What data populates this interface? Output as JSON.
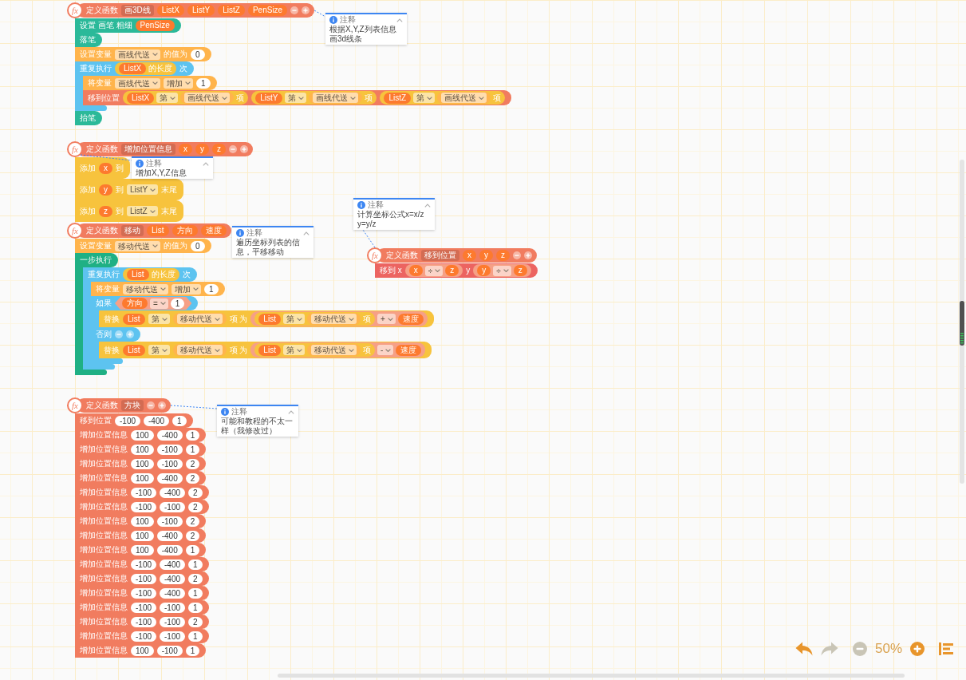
{
  "functions": [
    {
      "header": {
        "symbol": "fx",
        "parts": [
          {
            "kind": "label",
            "text": "定义函数"
          },
          {
            "kind": "name",
            "text": "画3D线"
          },
          {
            "kind": "variable",
            "text": "ListX"
          },
          {
            "kind": "variable",
            "text": "ListY"
          },
          {
            "kind": "variable",
            "text": "ListZ"
          },
          {
            "kind": "variable",
            "text": "PenSize"
          },
          {
            "kind": "mutator"
          }
        ]
      },
      "comment": {
        "title": "注释",
        "text": "根据X,Y,Z列表信息画3d线条"
      },
      "body": [
        {
          "kind": "pen",
          "parts": [
            {
              "kind": "label",
              "text": "设置 画笔 粗细"
            },
            {
              "kind": "variable",
              "text": "PenSize"
            }
          ]
        },
        {
          "kind": "pen",
          "parts": [
            {
              "kind": "label",
              "text": "落笔"
            }
          ]
        },
        {
          "kind": "variable",
          "parts": [
            {
              "kind": "label",
              "text": "设置变量"
            },
            {
              "kind": "dropdown",
              "text": "画线代送"
            },
            {
              "kind": "label",
              "text": "的值为"
            },
            {
              "kind": "number",
              "text": "0"
            }
          ]
        },
        {
          "kind": "repeat",
          "parts": [
            {
              "kind": "label",
              "text": "重复执行"
            },
            {
              "kind": "length",
              "parts": [
                {
                  "kind": "variable",
                  "text": "ListX"
                },
                {
                  "kind": "label",
                  "text": "的长度"
                }
              ]
            },
            {
              "kind": "label",
              "text": "次"
            }
          ],
          "children": [
            {
              "kind": "variable",
              "parts": [
                {
                  "kind": "label",
                  "text": "将变量"
                },
                {
                  "kind": "dropdown",
                  "text": "画线代送"
                },
                {
                  "kind": "dropdown",
                  "text": "增加"
                },
                {
                  "kind": "number",
                  "text": "1"
                }
              ]
            },
            {
              "kind": "function",
              "parts": [
                {
                  "kind": "label",
                  "text": "移到位置"
                },
                {
                  "kind": "list-item",
                  "parts": [
                    {
                      "kind": "variable",
                      "text": "ListX"
                    },
                    {
                      "kind": "dropdown",
                      "text": "第"
                    },
                    {
                      "kind": "getter",
                      "parts": [
                        {
                          "kind": "dropdown",
                          "text": "画线代送"
                        }
                      ]
                    },
                    {
                      "kind": "label",
                      "text": "项"
                    }
                  ]
                },
                {
                  "kind": "list-item",
                  "parts": [
                    {
                      "kind": "variable",
                      "text": "ListY"
                    },
                    {
                      "kind": "dropdown",
                      "text": "第"
                    },
                    {
                      "kind": "getter",
                      "parts": [
                        {
                          "kind": "dropdown",
                          "text": "画线代送"
                        }
                      ]
                    },
                    {
                      "kind": "label",
                      "text": "项"
                    }
                  ]
                },
                {
                  "kind": "list-item",
                  "parts": [
                    {
                      "kind": "variable",
                      "text": "ListZ"
                    },
                    {
                      "kind": "dropdown",
                      "text": "第"
                    },
                    {
                      "kind": "getter",
                      "parts": [
                        {
                          "kind": "dropdown",
                          "text": "画线代送"
                        }
                      ]
                    },
                    {
                      "kind": "label",
                      "text": "项"
                    }
                  ]
                }
              ]
            }
          ]
        },
        {
          "kind": "pen",
          "parts": [
            {
              "kind": "label",
              "text": "抬笔"
            }
          ]
        }
      ]
    },
    {
      "header": {
        "symbol": "fx",
        "parts": [
          {
            "kind": "label",
            "text": "定义函数"
          },
          {
            "kind": "name",
            "text": "增加位置信息"
          },
          {
            "kind": "variable",
            "text": "x"
          },
          {
            "kind": "variable",
            "text": "y"
          },
          {
            "kind": "variable",
            "text": "z"
          },
          {
            "kind": "mutator"
          }
        ]
      },
      "comment": {
        "title": "注释",
        "text": "增加X,Y,Z信息"
      },
      "body": [
        {
          "kind": "list",
          "parts": [
            {
              "kind": "label",
              "text": "添加"
            },
            {
              "kind": "variable",
              "text": "x"
            },
            {
              "kind": "label",
              "text": "到"
            }
          ]
        },
        {
          "kind": "list",
          "parts": [
            {
              "kind": "label",
              "text": "添加"
            },
            {
              "kind": "variable",
              "text": "y"
            },
            {
              "kind": "label",
              "text": "到"
            },
            {
              "kind": "dropdown",
              "text": "ListY"
            },
            {
              "kind": "label",
              "text": "末尾"
            }
          ]
        },
        {
          "kind": "list",
          "parts": [
            {
              "kind": "label",
              "text": "添加"
            },
            {
              "kind": "variable",
              "text": "z"
            },
            {
              "kind": "label",
              "text": "到"
            },
            {
              "kind": "dropdown",
              "text": "ListZ"
            },
            {
              "kind": "label",
              "text": "末尾"
            }
          ]
        }
      ]
    },
    {
      "header": {
        "symbol": "fx",
        "parts": [
          {
            "kind": "label",
            "text": "定义函数"
          },
          {
            "kind": "name",
            "text": "移动"
          },
          {
            "kind": "variable",
            "text": "List"
          },
          {
            "kind": "variable",
            "text": "方向"
          },
          {
            "kind": "variable",
            "text": "速度"
          }
        ]
      },
      "comment": {
        "title": "注释",
        "text": "遍历坐标列表的信息，平移移动"
      },
      "body": [
        {
          "kind": "variable",
          "parts": [
            {
              "kind": "label",
              "text": "设置变量"
            },
            {
              "kind": "dropdown",
              "text": "移动代送"
            },
            {
              "kind": "label",
              "text": "的值为"
            },
            {
              "kind": "number",
              "text": "0"
            }
          ]
        },
        {
          "kind": "sequence",
          "parts": [
            {
              "kind": "label",
              "text": "一步执行"
            }
          ],
          "children": [
            {
              "kind": "repeat",
              "parts": [
                {
                  "kind": "label",
                  "text": "重复执行"
                },
                {
                  "kind": "length",
                  "parts": [
                    {
                      "kind": "variable",
                      "text": "List"
                    },
                    {
                      "kind": "label",
                      "text": "的长度"
                    }
                  ]
                },
                {
                  "kind": "label",
                  "text": "次"
                }
              ],
              "children": [
                {
                  "kind": "variable",
                  "parts": [
                    {
                      "kind": "label",
                      "text": "将变量"
                    },
                    {
                      "kind": "dropdown",
                      "text": "移动代送"
                    },
                    {
                      "kind": "dropdown",
                      "text": "增加"
                    },
                    {
                      "kind": "number",
                      "text": "1"
                    }
                  ]
                },
                {
                  "kind": "if-else",
                  "parts": [
                    {
                      "kind": "label",
                      "text": "如果"
                    },
                    {
                      "kind": "condition",
                      "parts": [
                        {
                          "kind": "variable",
                          "text": "方向"
                        },
                        {
                          "kind": "dropdown",
                          "text": "="
                        },
                        {
                          "kind": "number",
                          "text": "1"
                        }
                      ]
                    }
                  ],
                  "children": [
                    {
                      "kind": "list",
                      "parts": [
                        {
                          "kind": "label",
                          "text": "替换"
                        },
                        {
                          "kind": "variable",
                          "text": "List"
                        },
                        {
                          "kind": "dropdown",
                          "text": "第"
                        },
                        {
                          "kind": "getter",
                          "parts": [
                            {
                              "kind": "dropdown",
                              "text": "移动代送"
                            }
                          ]
                        },
                        {
                          "kind": "label",
                          "text": "项 为"
                        },
                        {
                          "kind": "math",
                          "parts": [
                            {
                              "kind": "list-item",
                              "parts": [
                                {
                                  "kind": "variable",
                                  "text": "List"
                                },
                                {
                                  "kind": "dropdown",
                                  "text": "第"
                                },
                                {
                                  "kind": "getter",
                                  "parts": [
                                    {
                                      "kind": "dropdown",
                                      "text": "移动代送"
                                    }
                                  ]
                                },
                                {
                                  "kind": "label",
                                  "text": "项"
                                }
                              ]
                            },
                            {
                              "kind": "dropdown",
                              "text": "+"
                            },
                            {
                              "kind": "variable",
                              "text": "速度"
                            }
                          ]
                        }
                      ]
                    }
                  ],
                  "else_parts": [
                    {
                      "kind": "label",
                      "text": "否则"
                    },
                    {
                      "kind": "mutator"
                    }
                  ],
                  "else_children": [
                    {
                      "kind": "list",
                      "parts": [
                        {
                          "kind": "label",
                          "text": "替换"
                        },
                        {
                          "kind": "variable",
                          "text": "List"
                        },
                        {
                          "kind": "dropdown",
                          "text": "第"
                        },
                        {
                          "kind": "getter",
                          "parts": [
                            {
                              "kind": "dropdown",
                              "text": "移动代送"
                            }
                          ]
                        },
                        {
                          "kind": "label",
                          "text": "项 为"
                        },
                        {
                          "kind": "math",
                          "parts": [
                            {
                              "kind": "list-item",
                              "parts": [
                                {
                                  "kind": "variable",
                                  "text": "List"
                                },
                                {
                                  "kind": "dropdown",
                                  "text": "第"
                                },
                                {
                                  "kind": "getter",
                                  "parts": [
                                    {
                                      "kind": "dropdown",
                                      "text": "移动代送"
                                    }
                                  ]
                                },
                                {
                                  "kind": "label",
                                  "text": "项"
                                }
                              ]
                            },
                            {
                              "kind": "dropdown",
                              "text": "-"
                            },
                            {
                              "kind": "variable",
                              "text": "速度"
                            }
                          ]
                        }
                      ]
                    }
                  ]
                }
              ]
            }
          ]
        }
      ]
    },
    {
      "header": {
        "symbol": "fx",
        "parts": [
          {
            "kind": "label",
            "text": "定义函数"
          },
          {
            "kind": "name",
            "text": "移到位置"
          },
          {
            "kind": "variable",
            "text": "x"
          },
          {
            "kind": "variable",
            "text": "y"
          },
          {
            "kind": "variable",
            "text": "z"
          },
          {
            "kind": "mutator"
          }
        ]
      },
      "comment": {
        "title": "注释",
        "text": "计算坐标公式x=x/z y=y/z"
      },
      "body": [
        {
          "kind": "motion",
          "parts": [
            {
              "kind": "label",
              "text": "移到 x"
            },
            {
              "kind": "math",
              "parts": [
                {
                  "kind": "variable",
                  "text": "x"
                },
                {
                  "kind": "dropdown",
                  "text": "÷"
                },
                {
                  "kind": "variable",
                  "text": "z"
                }
              ]
            },
            {
              "kind": "label",
              "text": "y"
            },
            {
              "kind": "math",
              "parts": [
                {
                  "kind": "variable",
                  "text": "y"
                },
                {
                  "kind": "dropdown",
                  "text": "÷"
                },
                {
                  "kind": "variable",
                  "text": "z"
                }
              ]
            }
          ]
        }
      ]
    },
    {
      "header": {
        "symbol": "fx",
        "parts": [
          {
            "kind": "label",
            "text": "定义函数"
          },
          {
            "kind": "name",
            "text": "方块"
          },
          {
            "kind": "mutator"
          }
        ]
      },
      "comment": {
        "title": "注释",
        "text": "可能和教程的不太一样（我修改过）"
      },
      "body": [
        {
          "kind": "function",
          "parts": [
            {
              "kind": "label",
              "text": "移到位置"
            },
            {
              "kind": "number",
              "text": "-100"
            },
            {
              "kind": "number",
              "text": "-400"
            },
            {
              "kind": "number",
              "text": "1"
            }
          ]
        },
        {
          "kind": "function",
          "parts": [
            {
              "kind": "label",
              "text": "增加位置信息"
            },
            {
              "kind": "number",
              "text": "100"
            },
            {
              "kind": "number",
              "text": "-400"
            },
            {
              "kind": "number",
              "text": "1"
            }
          ]
        },
        {
          "kind": "function",
          "parts": [
            {
              "kind": "label",
              "text": "增加位置信息"
            },
            {
              "kind": "number",
              "text": "100"
            },
            {
              "kind": "number",
              "text": "-100"
            },
            {
              "kind": "number",
              "text": "1"
            }
          ]
        },
        {
          "kind": "function",
          "parts": [
            {
              "kind": "label",
              "text": "增加位置信息"
            },
            {
              "kind": "number",
              "text": "100"
            },
            {
              "kind": "number",
              "text": "-100"
            },
            {
              "kind": "number",
              "text": "2"
            }
          ]
        },
        {
          "kind": "function",
          "parts": [
            {
              "kind": "label",
              "text": "增加位置信息"
            },
            {
              "kind": "number",
              "text": "100"
            },
            {
              "kind": "number",
              "text": "-400"
            },
            {
              "kind": "number",
              "text": "2"
            }
          ]
        },
        {
          "kind": "function",
          "parts": [
            {
              "kind": "label",
              "text": "增加位置信息"
            },
            {
              "kind": "number",
              "text": "-100"
            },
            {
              "kind": "number",
              "text": "-400"
            },
            {
              "kind": "number",
              "text": "2"
            }
          ]
        },
        {
          "kind": "function",
          "parts": [
            {
              "kind": "label",
              "text": "增加位置信息"
            },
            {
              "kind": "number",
              "text": "-100"
            },
            {
              "kind": "number",
              "text": "-100"
            },
            {
              "kind": "number",
              "text": "2"
            }
          ]
        },
        {
          "kind": "function",
          "parts": [
            {
              "kind": "label",
              "text": "增加位置信息"
            },
            {
              "kind": "number",
              "text": "100"
            },
            {
              "kind": "number",
              "text": "-100"
            },
            {
              "kind": "number",
              "text": "2"
            }
          ]
        },
        {
          "kind": "function",
          "parts": [
            {
              "kind": "label",
              "text": "增加位置信息"
            },
            {
              "kind": "number",
              "text": "100"
            },
            {
              "kind": "number",
              "text": "-400"
            },
            {
              "kind": "number",
              "text": "2"
            }
          ]
        },
        {
          "kind": "function",
          "parts": [
            {
              "kind": "label",
              "text": "增加位置信息"
            },
            {
              "kind": "number",
              "text": "100"
            },
            {
              "kind": "number",
              "text": "-400"
            },
            {
              "kind": "number",
              "text": "1"
            }
          ]
        },
        {
          "kind": "function",
          "parts": [
            {
              "kind": "label",
              "text": "增加位置信息"
            },
            {
              "kind": "number",
              "text": "-100"
            },
            {
              "kind": "number",
              "text": "-400"
            },
            {
              "kind": "number",
              "text": "1"
            }
          ]
        },
        {
          "kind": "function",
          "parts": [
            {
              "kind": "label",
              "text": "增加位置信息"
            },
            {
              "kind": "number",
              "text": "-100"
            },
            {
              "kind": "number",
              "text": "-400"
            },
            {
              "kind": "number",
              "text": "2"
            }
          ]
        },
        {
          "kind": "function",
          "parts": [
            {
              "kind": "label",
              "text": "增加位置信息"
            },
            {
              "kind": "number",
              "text": "-100"
            },
            {
              "kind": "number",
              "text": "-400"
            },
            {
              "kind": "number",
              "text": "1"
            }
          ]
        },
        {
          "kind": "function",
          "parts": [
            {
              "kind": "label",
              "text": "增加位置信息"
            },
            {
              "kind": "number",
              "text": "-100"
            },
            {
              "kind": "number",
              "text": "-100"
            },
            {
              "kind": "number",
              "text": "1"
            }
          ]
        },
        {
          "kind": "function",
          "parts": [
            {
              "kind": "label",
              "text": "增加位置信息"
            },
            {
              "kind": "number",
              "text": "-100"
            },
            {
              "kind": "number",
              "text": "-100"
            },
            {
              "kind": "number",
              "text": "2"
            }
          ]
        },
        {
          "kind": "function",
          "parts": [
            {
              "kind": "label",
              "text": "增加位置信息"
            },
            {
              "kind": "number",
              "text": "-100"
            },
            {
              "kind": "number",
              "text": "-100"
            },
            {
              "kind": "number",
              "text": "1"
            }
          ]
        },
        {
          "kind": "function",
          "parts": [
            {
              "kind": "label",
              "text": "增加位置信息"
            },
            {
              "kind": "number",
              "text": "100"
            },
            {
              "kind": "number",
              "text": "-100"
            },
            {
              "kind": "number",
              "text": "1"
            }
          ]
        }
      ]
    }
  ],
  "toolbar": [
    {
      "kind": "undo",
      "disabled": false
    },
    {
      "kind": "redo",
      "disabled": true
    },
    {
      "kind": "zoom-out",
      "disabled": true
    },
    {
      "kind": "zoom-level",
      "text": "50%"
    },
    {
      "kind": "zoom-in",
      "disabled": false
    },
    {
      "kind": "cleanup"
    }
  ]
}
